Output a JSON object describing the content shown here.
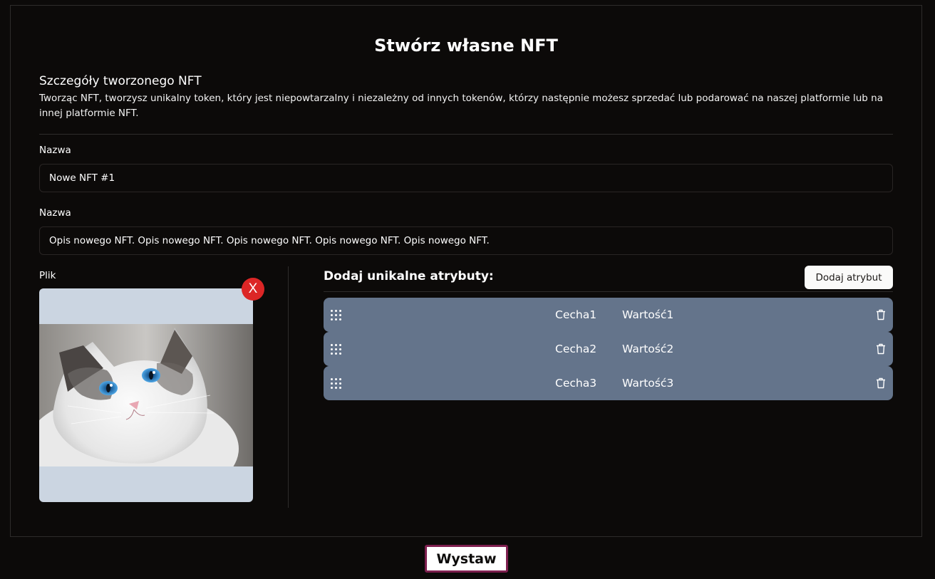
{
  "page": {
    "title": "Stwórz własne NFT"
  },
  "details": {
    "title": "Szczegóły tworzonego NFT",
    "description": "Tworząc NFT, tworzysz unikalny token, który jest niepowtarzalny i niezależny od innych tokenów, którzy następnie możesz sprzedać lub podarować na naszej platformie lub na innej platformie NFT."
  },
  "form": {
    "name_label": "Nazwa",
    "name_value": "Nowe NFT #1",
    "description_label": "Nazwa",
    "description_value": "Opis nowego NFT. Opis nowego NFT. Opis nowego NFT. Opis nowego NFT. Opis nowego NFT.",
    "file_label": "Plik",
    "remove_file_label": "X"
  },
  "attributes": {
    "title": "Dodaj unikalne atrybuty:",
    "add_button_label": "Dodaj atrybut",
    "items": [
      {
        "key": "Cecha1",
        "value": "Wartość1"
      },
      {
        "key": "Cecha2",
        "value": "Wartość2"
      },
      {
        "key": "Cecha3",
        "value": "Wartość3"
      }
    ]
  },
  "footer": {
    "submit_label": "Wystaw"
  },
  "icons": {
    "drag": "grip-icon",
    "delete": "trash-icon",
    "remove": "close-icon"
  },
  "colors": {
    "background": "#0c0a09",
    "attribute_row": "#64748b",
    "remove_button": "#dc2626",
    "submit_border": "#7e1f4f",
    "file_frame": "#cbd5e1"
  }
}
